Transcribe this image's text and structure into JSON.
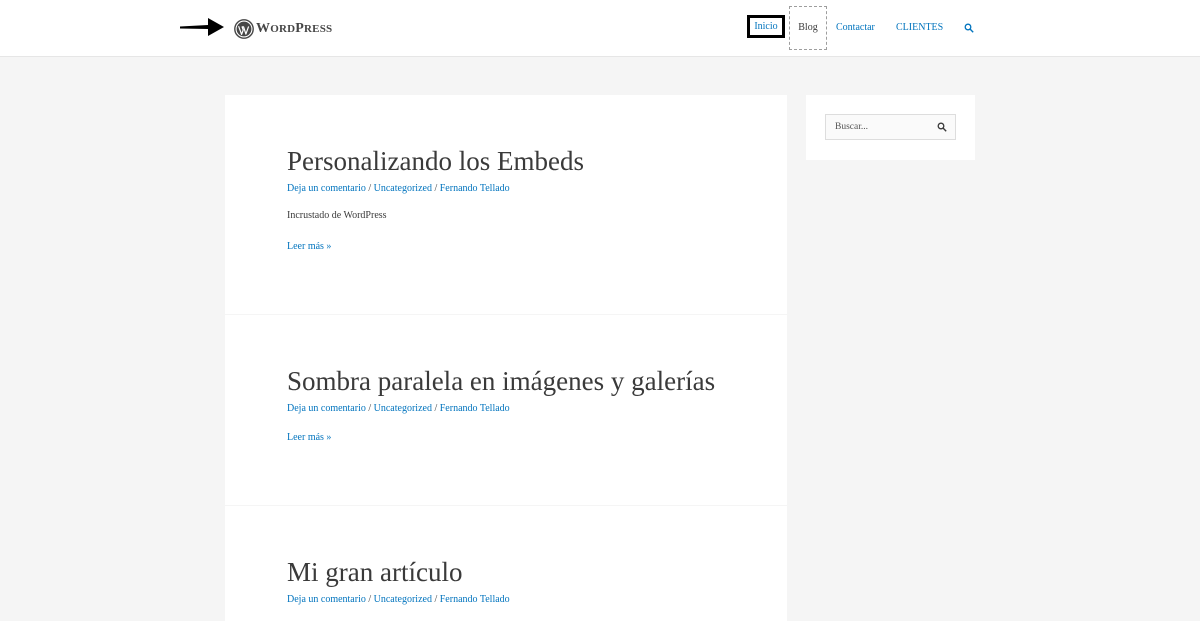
{
  "header": {
    "logo": {
      "text_big": "W",
      "text_rest": "ORD",
      "text_p": "P",
      "text_ress": "RESS"
    },
    "nav": {
      "inicio": "Inicio",
      "blog": "Blog",
      "contactar": "Contactar",
      "clientes": "CLIENTES"
    },
    "icons": {
      "search": "search-icon",
      "annotation": "arrow-right-icon"
    }
  },
  "posts": [
    {
      "title": "Personalizando los Embeds",
      "meta": {
        "comment": "Deja un comentario",
        "category": "Uncategorized",
        "author": "Fernando Tellado",
        "separator": "/"
      },
      "excerpt": "Incrustado de WordPress",
      "read_more": "Leer más »"
    },
    {
      "title": "Sombra paralela en imágenes y galerías",
      "meta": {
        "comment": "Deja un comentario",
        "category": "Uncategorized",
        "author": "Fernando Tellado",
        "separator": "/"
      },
      "read_more": "Leer más »"
    },
    {
      "title": "Mi gran artículo",
      "meta": {
        "comment": "Deja un comentario",
        "category": "Uncategorized",
        "author": "Fernando Tellado",
        "separator": "/"
      }
    }
  ],
  "sidebar": {
    "search": {
      "placeholder": "Buscar..."
    }
  },
  "colors": {
    "link": "#0274be",
    "text": "#3a3a3a",
    "background": "#f5f5f5"
  }
}
